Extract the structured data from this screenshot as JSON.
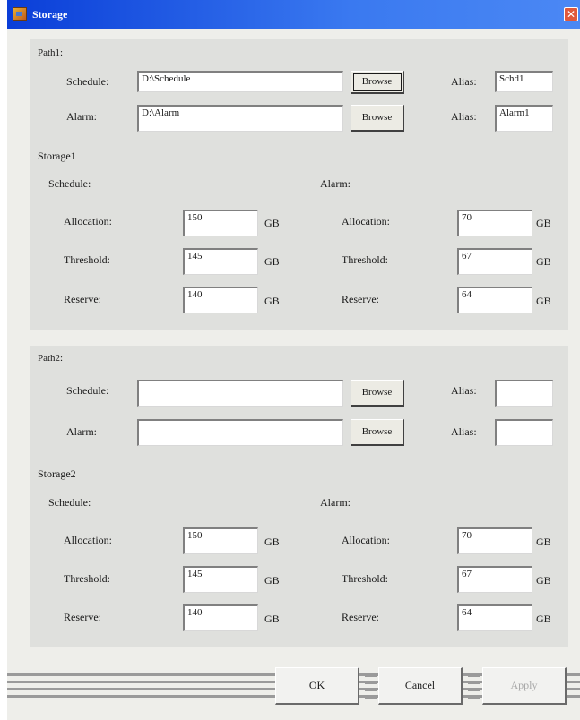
{
  "window": {
    "title": "Storage"
  },
  "path1": {
    "label": "Path1:",
    "schedule_label": "Schedule:",
    "schedule_path": "D:\\Schedule",
    "alarm_label": "Alarm:",
    "alarm_path": "D:\\Alarm",
    "browse_label": "Browse",
    "alias_label": "Alias:",
    "schedule_alias": "Schd1",
    "alarm_alias": "Alarm1"
  },
  "storage1": {
    "label": "Storage1",
    "schedule_heading": "Schedule:",
    "alarm_heading": "Alarm:",
    "allocation_label": "Allocation:",
    "threshold_label": "Threshold:",
    "reserve_label": "Reserve:",
    "unit": "GB",
    "schedule": {
      "allocation": "150",
      "threshold": "145",
      "reserve": "140"
    },
    "alarm": {
      "allocation": "70",
      "threshold": "67",
      "reserve": "64"
    }
  },
  "path2": {
    "label": "Path2:",
    "schedule_label": "Schedule:",
    "schedule_path": "",
    "alarm_label": "Alarm:",
    "alarm_path": "",
    "browse_label": "Browse",
    "alias_label": "Alias:",
    "schedule_alias": "",
    "alarm_alias": ""
  },
  "storage2": {
    "label": "Storage2",
    "schedule_heading": "Schedule:",
    "alarm_heading": "Alarm:",
    "allocation_label": "Allocation:",
    "threshold_label": "Threshold:",
    "reserve_label": "Reserve:",
    "unit": "GB",
    "schedule": {
      "allocation": "150",
      "threshold": "145",
      "reserve": "140"
    },
    "alarm": {
      "allocation": "70",
      "threshold": "67",
      "reserve": "64"
    }
  },
  "buttons": {
    "ok": "OK",
    "cancel": "Cancel",
    "apply": "Apply"
  }
}
